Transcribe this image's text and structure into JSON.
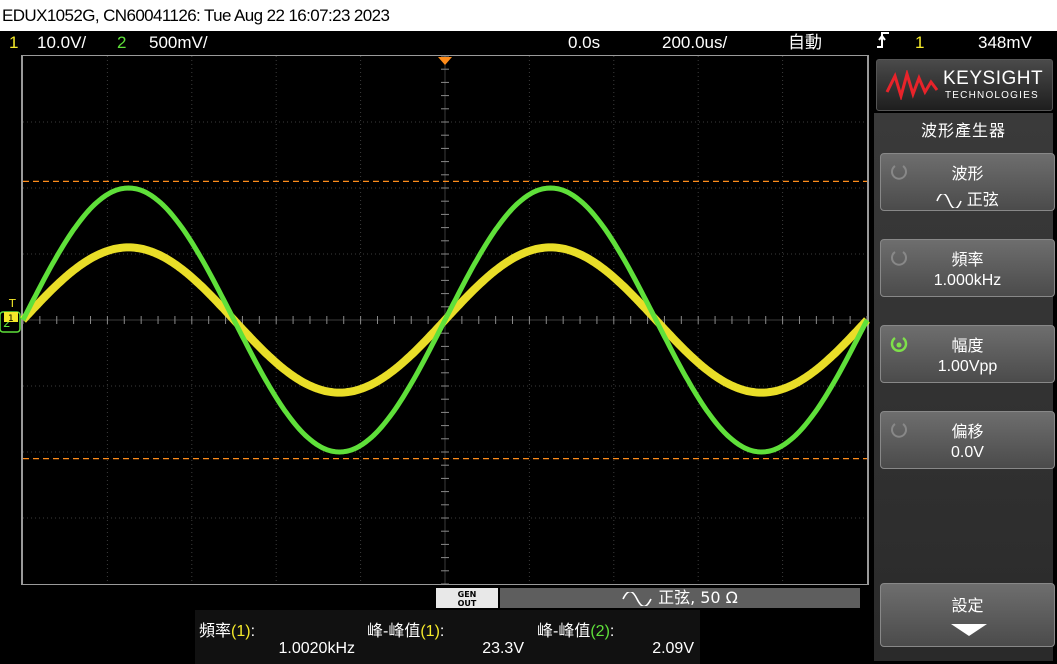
{
  "title_bar": {
    "text": "EDUX1052G, CN60041126: Tue Aug 22 16:07:23 2023"
  },
  "status_bar": {
    "ch1_num": "1",
    "ch1_scale": "10.0V/",
    "ch2_num": "2",
    "ch2_scale": "500mV/",
    "time_delay": "0.0s",
    "time_scale": "200.0us/",
    "trigger_mode": "自動",
    "trigger_icon": "rising-edge-icon",
    "trigger_source": "1",
    "trigger_level": "348mV"
  },
  "colors": {
    "ch1": "#f5ea2a",
    "ch2": "#5fe03a",
    "cursor": "#ff8c1a"
  },
  "side_panel": {
    "brand": "KEYSIGHT",
    "brand_sub": "TECHNOLOGIES",
    "menu_title": "波形產生器",
    "softkeys": [
      {
        "label": "波形",
        "value": "正弦",
        "active": false
      },
      {
        "label": "頻率",
        "value": "1.000kHz",
        "active": false
      },
      {
        "label": "幅度",
        "value": "1.00Vpp",
        "active": true
      },
      {
        "label": "偏移",
        "value": "0.0V",
        "active": false
      },
      {
        "label": "設定",
        "value": ""
      }
    ]
  },
  "gen_bar": {
    "badge": "GEN OUT",
    "badge_line1": "GEN",
    "badge_line2": "OUT",
    "text": "正弦, 50 Ω"
  },
  "measurements": [
    {
      "label": "頻率",
      "channel": "(1)",
      "suffix": ":",
      "value": "1.0020kHz"
    },
    {
      "label": "峰-峰值",
      "channel": "(1)",
      "suffix": ":",
      "value": "23.3V"
    },
    {
      "label": "峰-峰值",
      "channel": "(2)",
      "suffix": ":",
      "value": "2.09V"
    }
  ],
  "markers": {
    "ground_ch1": "1",
    "ground_ch2": "2",
    "trigger_level_mark": "T"
  },
  "chart_data": {
    "type": "line",
    "x_unit": "time divisions",
    "xlim": [
      0,
      10
    ],
    "ylim": [
      -4,
      4
    ],
    "grid": true,
    "series": [
      {
        "name": "1",
        "amplitude_div": 1.1,
        "period_div": 5.0,
        "phase": 0
      },
      {
        "name": "2",
        "amplitude_div": 2.0,
        "period_div": 5.0,
        "phase": 0
      }
    ],
    "cursors_div": [
      2.1,
      -2.1
    ]
  }
}
